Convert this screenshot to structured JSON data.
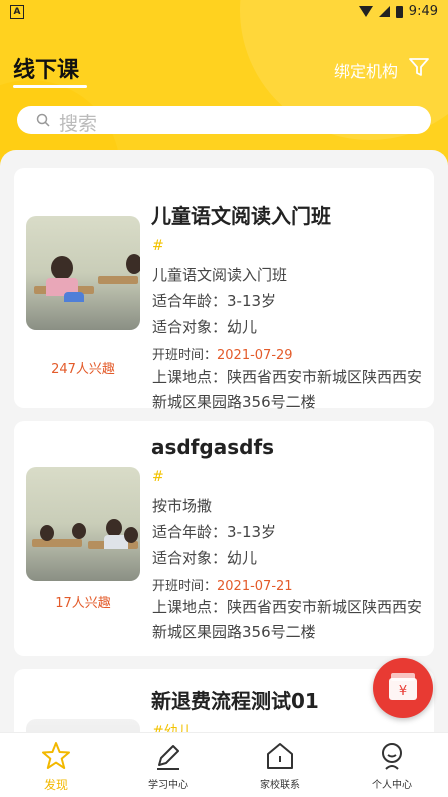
{
  "status_bar": {
    "left_icon": "A",
    "time": "9:49"
  },
  "header": {
    "title": "线下课",
    "bind_org": "绑定机构",
    "filter_icon": "filter-icon"
  },
  "search": {
    "placeholder": "搜索"
  },
  "courses": [
    {
      "title": "儿童语文阅读入门班",
      "tag": "#",
      "subtitle": "儿童语文阅读入门班",
      "age": "适合年龄：3-13岁",
      "audience": "适合对象：幼儿",
      "start_label": "开班时间：",
      "start_date": "2021-07-29",
      "address": "上课地点：陕西省西安市新城区陕西西安新城区果园路356号二楼",
      "interest": "247人兴趣"
    },
    {
      "title": "asdfgasdfs",
      "tag": "#",
      "subtitle": "按市场撒",
      "age": "适合年龄：3-13岁",
      "audience": "适合对象：幼儿",
      "start_label": "开班时间：",
      "start_date": "2021-07-21",
      "address": "上课地点：陕西省西安市新城区陕西西安新城区果园路356号二楼",
      "interest": "17人兴趣"
    },
    {
      "title": "新退费流程测试01",
      "tag": "#幼儿"
    }
  ],
  "tabs": [
    {
      "label": "发现",
      "icon": "star-icon",
      "active": true
    },
    {
      "label": "学习中心",
      "icon": "pen-icon",
      "active": false
    },
    {
      "label": "家校联系",
      "icon": "home-icon",
      "active": false
    },
    {
      "label": "个人中心",
      "icon": "person-icon",
      "active": false
    }
  ],
  "colors": {
    "brand": "#ffd21f",
    "accent": "#e35b2a",
    "tag": "#f2c200",
    "refund": "#e83a33"
  }
}
